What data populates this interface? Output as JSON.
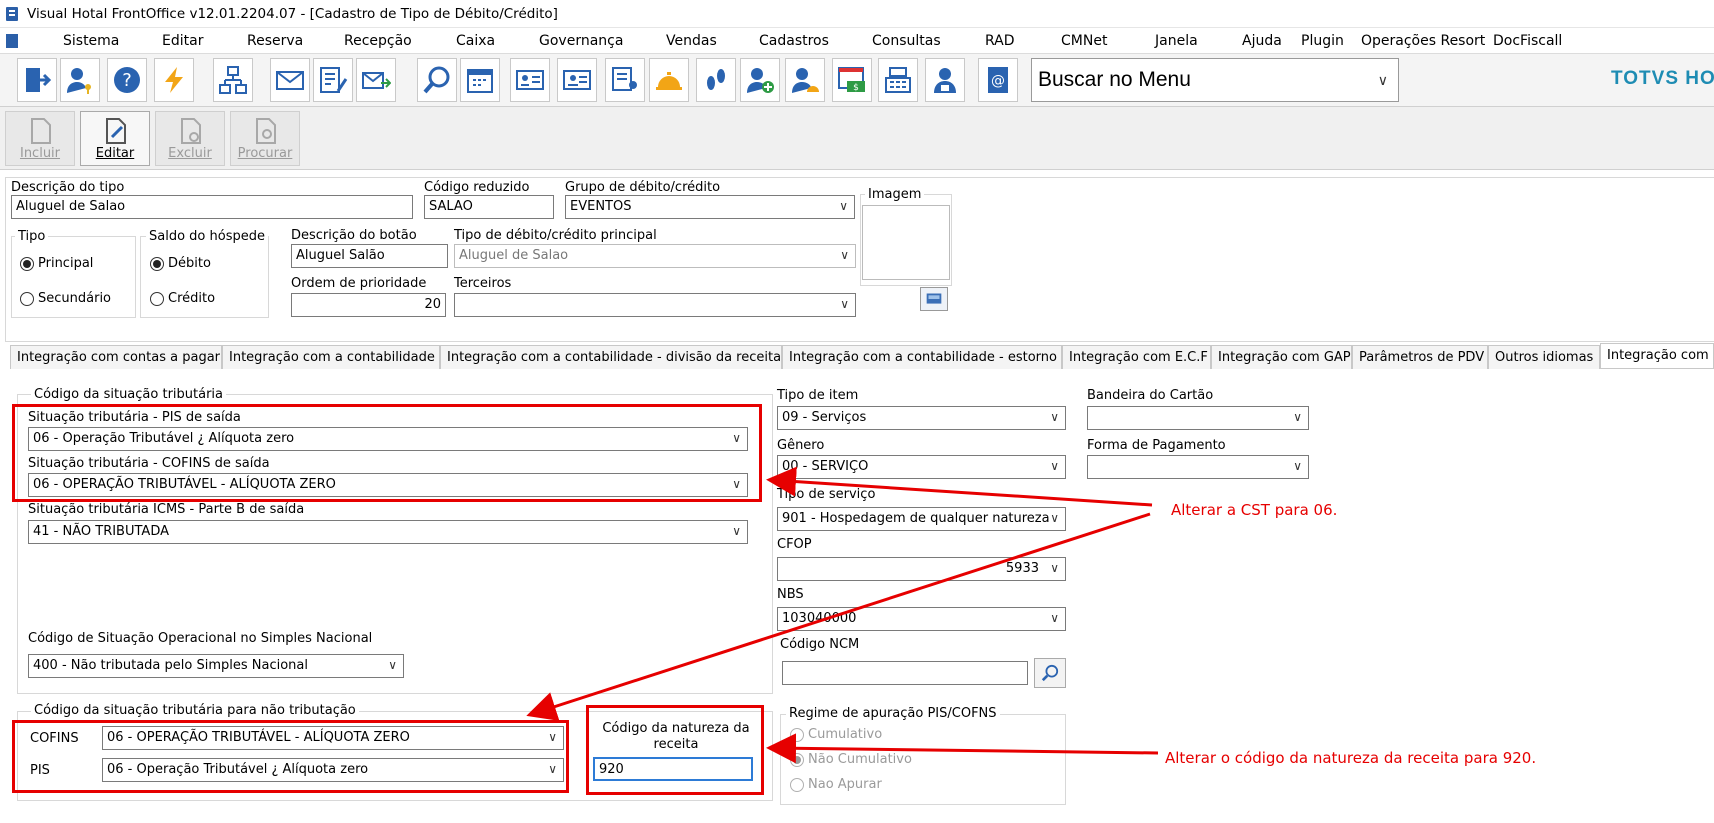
{
  "window": {
    "title": "Visual Hotal FrontOffice v12.01.2204.07 - [Cadastro de Tipo de Débito/Crédito]"
  },
  "menu": [
    "Sistema",
    "Editar",
    "Reserva",
    "Recepção",
    "Caixa",
    "Governança",
    "Vendas",
    "Cadastros",
    "Consultas",
    "RAD",
    "CMNet",
    "Janela",
    "Ajuda",
    "Plugin",
    "Operações Resort",
    "DocFiscall"
  ],
  "toolbar": {
    "search_value": "Buscar no Menu",
    "brand": "TOTVS HOT"
  },
  "actions": {
    "incluir": "Incluir",
    "editar": "Editar",
    "excluir": "Excluir",
    "procurar": "Procurar"
  },
  "form": {
    "descricao_label": "Descrição do tipo",
    "descricao_value": "Aluguel de Salao",
    "codigo_reduzido_label": "Código reduzido",
    "codigo_reduzido_value": "SALAO",
    "grupo_label": "Grupo de débito/crédito",
    "grupo_value": "EVENTOS",
    "imagem_label": "Imagem",
    "tipo_label": "Tipo",
    "tipo_principal": "Principal",
    "tipo_secundario": "Secundário",
    "saldo_label": "Saldo do hóspede",
    "saldo_debito": "Débito",
    "saldo_credito": "Crédito",
    "botao_label": "Descrição do botão",
    "botao_value": "Aluguel Salão",
    "tipo_principal_label": "Tipo de débito/crédito principal",
    "tipo_principal_value": "Aluguel de Salao",
    "ordem_label": "Ordem de prioridade",
    "ordem_value": "20",
    "terceiros_label": "Terceiros",
    "terceiros_value": ""
  },
  "tabs": [
    "Integração com contas a pagar",
    "Integração com a contabilidade",
    "Integração com a contabilidade - divisão da receita",
    "Integração com a contabilidade - estorno",
    "Integração com E.C.F",
    "Integração com GAP",
    "Parâmetros de PDV",
    "Outros idiomas",
    "Integração com I"
  ],
  "cst": {
    "group_label": "Código da situação tributária",
    "pis_label": "Situação tributária - PIS de saída",
    "pis_value": "06 - Operação Tributável ¿ Alíquota zero",
    "cofins_label": "Situação tributária - COFINS de saída",
    "cofins_value": "06 - OPERAÇÃO TRIBUTÁVEL - ALÍQUOTA ZERO",
    "icms_label": "Situação tributária ICMS -  Parte B de saída",
    "icms_value": "41 - NÃO TRIBUTADA",
    "simples_label": "Código de Situação Operacional no Simples Nacional",
    "simples_value": "400 - Não tributada pelo Simples Nacional"
  },
  "nao_trib": {
    "group_label": "Código da situação tributária para não tributação",
    "cofins_label": "COFINS",
    "cofins_value": "06 - OPERAÇÃO TRIBUTÁVEL - ALÍQUOTA ZERO",
    "pis_label": "PIS",
    "pis_value": "06 - Operação Tributável ¿ Alíquota zero",
    "natureza_label": "Código da natureza da receita",
    "natureza_value": "920"
  },
  "right": {
    "tipo_item_label": "Tipo de item",
    "tipo_item_value": "09 - Serviços",
    "genero_label": "Gênero",
    "genero_value": "00 - SERVIÇO",
    "tipo_servico_label": "Tipo de serviço",
    "tipo_servico_value": "901 - Hospedagem de qualquer natureza",
    "cfop_label": "CFOP",
    "cfop_value": "5933",
    "nbs_label": "NBS",
    "nbs_value": "103040000",
    "ncm_label": "Código NCM",
    "ncm_value": "",
    "bandeira_label": "Bandeira do Cartão",
    "bandeira_value": "",
    "forma_label": "Forma de Pagamento",
    "forma_value": "",
    "regime_label": "Regime de apuração PIS/COFNS",
    "regime_cumulativo": "Cumulativo",
    "regime_nao_cumulativo": "Não Cumulativo",
    "regime_nao_apurar": "Nao Apurar"
  },
  "annotations": {
    "note1": "Alterar a CST para 06.",
    "note2": "Alterar o código da natureza da receita para 920.",
    "color": "#e60000"
  }
}
